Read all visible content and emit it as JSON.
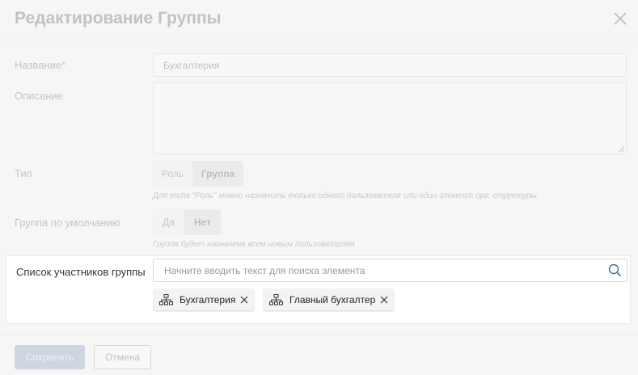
{
  "dialog": {
    "title": "Редактирование Группы"
  },
  "form": {
    "name": {
      "label": "Название",
      "required_mark": "*",
      "value": "Бухгалтерия"
    },
    "description": {
      "label": "Описание",
      "value": ""
    },
    "type": {
      "label": "Тип",
      "options": [
        "Роль",
        "Группа"
      ],
      "selected": "Группа",
      "hint": "Для типа \"Роль\" можно назначить только одного пользователя или один элемент орг. структуры"
    },
    "default_group": {
      "label": "Группа по умолчанию",
      "options": [
        "Да",
        "Нет"
      ],
      "selected": "Нет",
      "hint": "Группа будет назначена всем новым пользователям"
    },
    "members": {
      "label": "Список участников группы",
      "search_placeholder": "Начните вводить текст для поиска элемента",
      "chips": [
        {
          "label": "Бухгалтерия",
          "icon": "org-structure-icon"
        },
        {
          "label": "Главный бухгалтер",
          "icon": "org-structure-icon"
        }
      ]
    }
  },
  "footer": {
    "save_label": "Сохранить",
    "cancel_label": "Отмена"
  }
}
